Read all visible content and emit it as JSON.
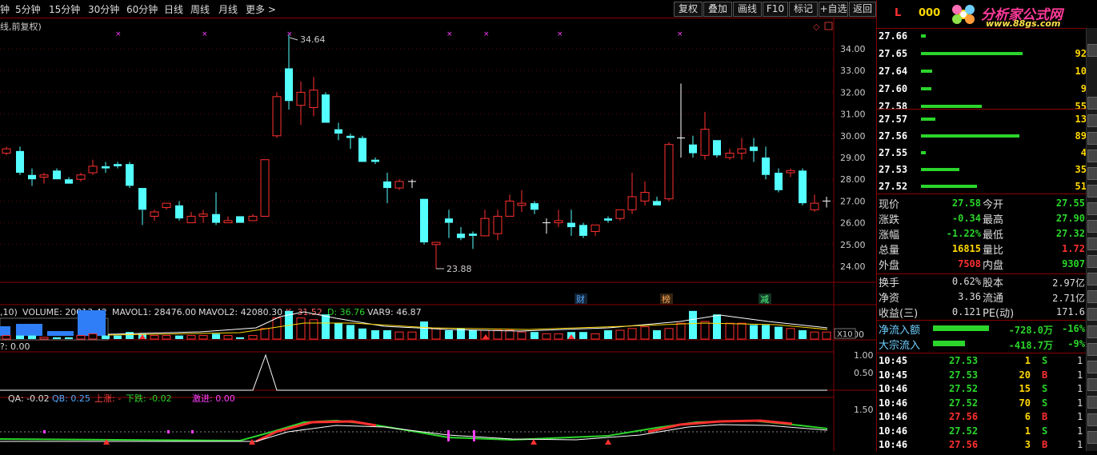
{
  "toolbar": {
    "periods": [
      "钟",
      "5分钟",
      "15分钟",
      "30分钟",
      "60分钟",
      "日线",
      "周线",
      "月线",
      "更多 >"
    ],
    "buttons": [
      "复权",
      "叠加",
      "画线",
      "F10",
      "标记",
      "+自选",
      "返回"
    ]
  },
  "kline": {
    "title": "线,前复权)",
    "high_label": "34.64",
    "low_label": "23.88",
    "price_axis": [
      "34.00",
      "33.00",
      "32.00",
      "31.00",
      "30.00",
      "29.00",
      "28.00",
      "27.00",
      "26.00",
      "25.00",
      "24.00"
    ],
    "event_tags": [
      "财",
      "榜",
      "减"
    ]
  },
  "volume_panel": {
    "header": {
      "prefix": ",10)",
      "volume": "VOLUME: 20013.42",
      "mavol1": "MAVOL1: 28476.00",
      "mavol2": "MAVOL2: 42080.30",
      "k": "K: 31.52",
      "d": "D: 36.76",
      "var9": "VAR9: 46.87"
    },
    "axis": "10000",
    "unit": "X10"
  },
  "signal_panel": {
    "header": "?: 0.00",
    "axis": [
      "1.00",
      "0.50"
    ]
  },
  "qa_panel": {
    "qa": "QA: -0.02",
    "qb": "QB: 0.25",
    "up": "上涨: -",
    "down": "下跌: -0.02",
    "jin": "激进: 0.00",
    "axis": "1.50"
  },
  "header_code": "L",
  "header_code2": "000",
  "logo": {
    "title": "分析家公式网",
    "url": "www.88gs.com"
  },
  "sell_book": [
    {
      "price": "27.66",
      "vol": "",
      "bar": 6
    },
    {
      "price": "27.65",
      "vol": "92",
      "bar": 127
    },
    {
      "price": "27.64",
      "vol": "10",
      "bar": 14
    },
    {
      "price": "27.60",
      "vol": "9",
      "bar": 13
    },
    {
      "price": "27.58",
      "vol": "55",
      "bar": 76
    }
  ],
  "buy_book": [
    {
      "price": "27.57",
      "vol": "13",
      "bar": 18
    },
    {
      "price": "27.56",
      "vol": "89",
      "bar": 123
    },
    {
      "price": "27.55",
      "vol": "4",
      "bar": 6
    },
    {
      "price": "27.53",
      "vol": "35",
      "bar": 48
    },
    {
      "price": "27.52",
      "vol": "51",
      "bar": 70
    }
  ],
  "quote": [
    {
      "l1": "现价",
      "v1": "27.58",
      "c1": "#2bd52b",
      "l2": "今开",
      "v2": "27.55",
      "c2": "#2bd52b"
    },
    {
      "l1": "涨跌",
      "v1": "-0.34",
      "c1": "#2bd52b",
      "l2": "最高",
      "v2": "27.90",
      "c2": "#2bd52b"
    },
    {
      "l1": "涨幅",
      "v1": "-1.22%",
      "c1": "#2bd52b",
      "l2": "最低",
      "v2": "27.32",
      "c2": "#2bd52b"
    },
    {
      "l1": "总量",
      "v1": "16815",
      "c1": "#ffd800",
      "l2": "量比",
      "v2": "1.72",
      "c2": "#ff3030"
    },
    {
      "l1": "外盘",
      "v1": "7508",
      "c1": "#ff3030",
      "l2": "内盘",
      "v2": "9307",
      "c2": "#2bd52b"
    }
  ],
  "quote2": [
    {
      "l1": "换手",
      "v1": "0.62%",
      "l2": "股本",
      "v2": "2.97亿"
    },
    {
      "l1": "净资",
      "v1": "3.36",
      "l2": "流通",
      "v2": "2.71亿"
    },
    {
      "l1": "收益(三)",
      "v1": "0.121",
      "l2": "PE(动)",
      "v2": "171.6"
    }
  ],
  "flow": [
    {
      "label": "净流入额",
      "value": "-728.0万",
      "pct": "-16%",
      "bar": 70
    },
    {
      "label": "大宗流入",
      "value": "-418.7万",
      "pct": "-9%",
      "bar": 40
    }
  ],
  "ticks": [
    {
      "time": "10:45",
      "price": "27.53",
      "vol": "1",
      "side": "S"
    },
    {
      "time": "10:45",
      "price": "27.53",
      "vol": "20",
      "side": "B"
    },
    {
      "time": "10:46",
      "price": "27.52",
      "vol": "15",
      "side": "S"
    },
    {
      "time": "10:46",
      "price": "27.52",
      "vol": "70",
      "side": "S"
    },
    {
      "time": "10:46",
      "price": "27.56",
      "vol": "6",
      "side": "B"
    },
    {
      "time": "10:46",
      "price": "27.52",
      "vol": "1",
      "side": "S"
    },
    {
      "time": "10:46",
      "price": "27.56",
      "vol": "3",
      "side": "B"
    }
  ],
  "tick_tail": [
    "1",
    "1",
    "1",
    "1",
    "1",
    "1",
    "1"
  ],
  "colors": {
    "up": "#ff3030",
    "down": "#54ffff",
    "green": "#2bd52b",
    "yellow": "#ffd800",
    "border": "#800000"
  }
}
